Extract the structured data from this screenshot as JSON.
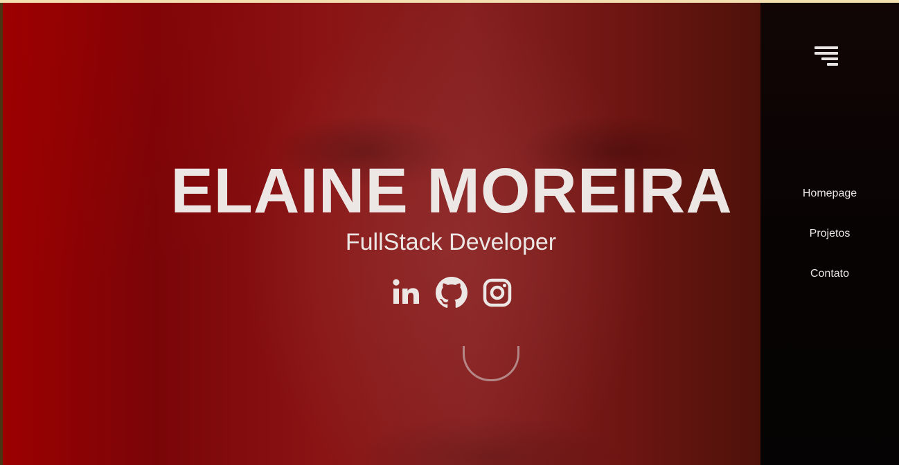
{
  "hero": {
    "name": "ELAINE MOREIRA",
    "role": "FullStack Developer",
    "socials": [
      {
        "icon": "linkedin-icon",
        "label": "LinkedIn"
      },
      {
        "icon": "github-icon",
        "label": "GitHub"
      },
      {
        "icon": "instagram-icon",
        "label": "Instagram"
      }
    ]
  },
  "sidebar": {
    "menu_icon": "menu-icon",
    "nav": [
      {
        "label": "Homepage"
      },
      {
        "label": "Projetos"
      },
      {
        "label": "Contato"
      }
    ]
  },
  "colors": {
    "accent_red": "#9c0000",
    "text": "#ece6e4",
    "sidebar_bg": "#080303",
    "top_strip": "#f3dfb0"
  }
}
